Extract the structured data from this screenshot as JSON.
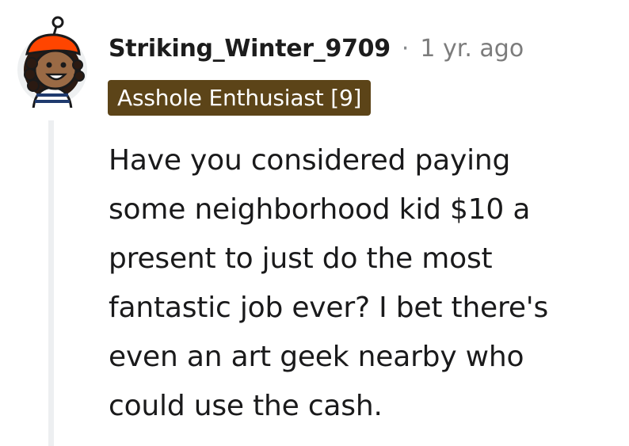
{
  "comment": {
    "author": "Striking_Winter_9709",
    "separator": "·",
    "timestamp": "1 yr. ago",
    "flair": "Asshole Enthusiast [9]",
    "body_lines": [
      "Have you considered paying",
      "some neighborhood kid $10 a",
      "present to just do the most",
      "fantastic job ever? I bet there's",
      "even an art geek nearby who",
      "could use the cash."
    ]
  },
  "colors": {
    "flair_background": "#5c4418",
    "flair_text": "#ffffff",
    "thread_line": "#edeff1",
    "username": "#1c1c1c",
    "timestamp": "#7c7c7c",
    "body_text": "#1a1a1b",
    "avatar_hat": "#ff4500"
  },
  "icons": {
    "avatar": "snoo-avatar-icon"
  }
}
